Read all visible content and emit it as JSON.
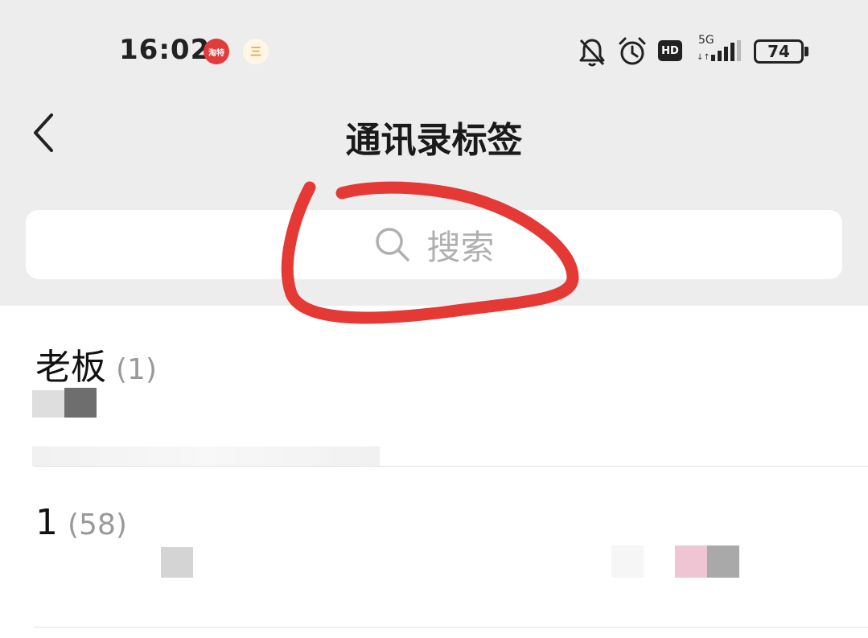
{
  "status_bar": {
    "time": "16:02",
    "app_icon_1": "淘特",
    "app_icon_2": "三",
    "hd_label": "HD",
    "network_label": "5G",
    "battery_level": "74"
  },
  "nav": {
    "title": "通讯录标签",
    "back_icon": "chevron-left-icon"
  },
  "search": {
    "placeholder": "搜索",
    "icon": "search-icon"
  },
  "groups": [
    {
      "name": "老板",
      "count": "(1)"
    },
    {
      "name": "1",
      "count": "(58)"
    }
  ],
  "colors": {
    "top_background": "#ededed",
    "annotation": "#e53935",
    "text_primary": "#111111",
    "text_secondary": "#999999"
  }
}
